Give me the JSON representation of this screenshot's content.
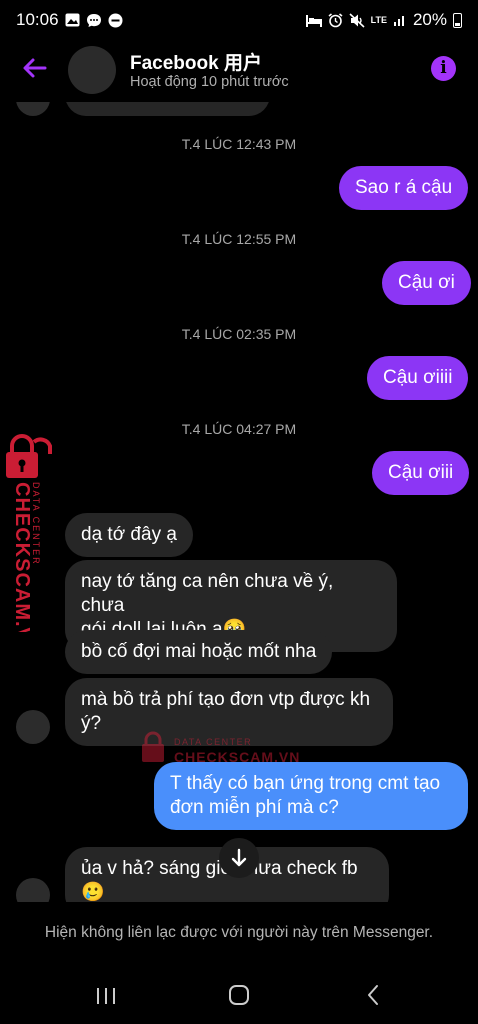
{
  "status": {
    "time": "10:06",
    "battery": "20%",
    "network": "LTE"
  },
  "header": {
    "contact_name": "Facebook 用户",
    "contact_status": "Hoạt động 10 phút trước"
  },
  "messages": [
    {
      "type": "timestamp",
      "text": "T.4 LÚC 12:43 PM"
    },
    {
      "type": "outgoing",
      "text": "Sao r á cậu"
    },
    {
      "type": "timestamp",
      "text": "T.4 LÚC 12:55 PM"
    },
    {
      "type": "outgoing",
      "text": "Cậu ơi"
    },
    {
      "type": "timestamp",
      "text": "T.4 LÚC 02:35 PM"
    },
    {
      "type": "outgoing",
      "text": "Cậu ơiiii"
    },
    {
      "type": "timestamp",
      "text": "T.4 LÚC 04:27 PM"
    },
    {
      "type": "outgoing",
      "text": "Cậu ơiii"
    },
    {
      "type": "incoming",
      "text": "dạ tớ đây ạ"
    },
    {
      "type": "incoming",
      "line1": "nay tớ tăng ca nên chưa về ý, chưa",
      "line2": "gói doll lại luôn ạ🥹"
    },
    {
      "type": "incoming",
      "text": "bồ cố đợi mai hoặc mốt nha"
    },
    {
      "type": "incoming",
      "line1": "mà bồ trả phí tạo đơn vtp được kh",
      "line2": "ý?"
    },
    {
      "type": "outgoing",
      "line1": "T thấy có bạn ứng trong cmt tạo",
      "line2": "đơn miễn phí mà c?"
    },
    {
      "type": "incoming",
      "line1": "ủa v hả? sáng giờ chưa check fb",
      "line2": "🥲"
    }
  ],
  "watermark": {
    "side_small": "DATA CENTER",
    "side_big": "CHECKSCAM.VN",
    "center_small": "DATA CENTER",
    "center_big": "CHECKSCAM.VN"
  },
  "footer": {
    "notice": "Hiện không liên lạc được với người này trên Messenger."
  },
  "colors": {
    "accent": "#8c36f5",
    "blue_bubble": "#4a8ffb",
    "incoming_bubble": "#262626",
    "watermark_red": "#e0213a"
  }
}
